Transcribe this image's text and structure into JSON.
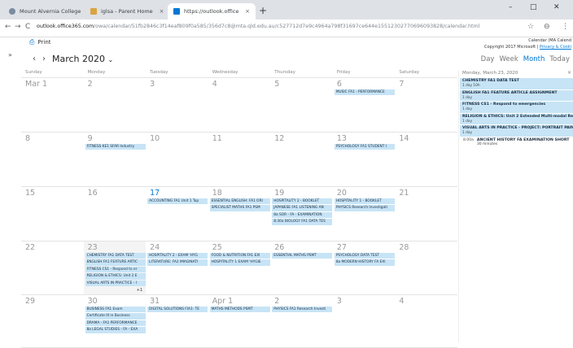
{
  "browser": {
    "tabs": [
      {
        "title": "Mount Alvernia College",
        "icon": "college-logo-icon",
        "active": false
      },
      {
        "title": "iglsa - Parent Home",
        "icon": "parent-portal-icon",
        "active": false
      },
      {
        "title": "https://outlook.office365.com/cale",
        "icon": "outlook-icon",
        "active": true
      }
    ],
    "new_tab": "+",
    "window_controls": [
      "–",
      "□",
      "✕"
    ],
    "url_domain": "outlook.office365.com",
    "url_rest": "/owa/calendar/51fb2846c3f14eaf809f0a585/356d7c8@mta.qld.edu.au/c527712d7e9c4964a798f31697ce644e15512302770696093828/calendar.html",
    "star": "☆",
    "account": "⊖",
    "menu": "⋮"
  },
  "print_label": "Print",
  "calendar_info": {
    "line1": "Calendar (MA Calend",
    "line2_prefix": "Copyright 2017 Microsoft |",
    "line2_link": "Privacy & Cooki"
  },
  "month_title": "March 2020",
  "views": [
    "Day",
    "Week",
    "Month",
    "Today"
  ],
  "active_view": "Month",
  "weekdays": [
    "Sunday",
    "Monday",
    "Tuesday",
    "Wednesday",
    "Thursday",
    "Friday",
    "Saturday"
  ],
  "weeks": [
    {
      "height": 67,
      "days": [
        {
          "num": "Mar 1",
          "events": []
        },
        {
          "num": "2",
          "events": []
        },
        {
          "num": "3",
          "events": []
        },
        {
          "num": "4",
          "events": []
        },
        {
          "num": "5",
          "events": []
        },
        {
          "num": "6",
          "events": [
            "MUSIC FA1 - PERFORMANCE"
          ]
        },
        {
          "num": "7",
          "events": []
        }
      ]
    },
    {
      "height": 67,
      "days": [
        {
          "num": "8",
          "events": []
        },
        {
          "num": "9",
          "events": [
            "FITNESS KE1 SFAR Industry"
          ]
        },
        {
          "num": "10",
          "events": []
        },
        {
          "num": "11",
          "events": []
        },
        {
          "num": "12",
          "events": []
        },
        {
          "num": "13",
          "events": [
            "PSYCHOLOGY FA1 STUDENT I"
          ]
        },
        {
          "num": "14",
          "events": []
        }
      ]
    },
    {
      "height": 67,
      "days": [
        {
          "num": "15",
          "events": []
        },
        {
          "num": "16",
          "events": []
        },
        {
          "num": "17",
          "blue": true,
          "events": [
            "ACCOUNTING FA1 Unit 1 Top"
          ]
        },
        {
          "num": "18",
          "events": [
            "ESSENTIAL ENGLISH: FA1 ORI",
            "SPECIALIST MATHS FA1 PSM"
          ]
        },
        {
          "num": "19",
          "events": [
            "HOSPITALITY 2 - BOOKLET",
            "JAPANESE FA1 LISTENING AN",
            "8a SOR - FA - EXAMINATION",
            "8:30a BIOLOGY FA1 DATA TES"
          ]
        },
        {
          "num": "20",
          "events": [
            "HOSPITALITY 1 - BOOKLET",
            "PHYSICS Research Investigati"
          ]
        },
        {
          "num": "21",
          "events": []
        }
      ]
    },
    {
      "height": 66,
      "days": [
        {
          "num": "22",
          "events": []
        },
        {
          "num": "23",
          "today": true,
          "events": [
            "CHEMISTRY FA1 DATA TEST",
            "ENGLISH FA1 FEATURE ARTIC",
            "FITNESS CS1 - Respond to er",
            "RELIGION & ETHICS: Unit 2 E",
            "VISUAL ARTS IN PRACTICE - I"
          ],
          "more": "+1"
        },
        {
          "num": "24",
          "events": [
            "HOSPITALITY 2 - EXAM 'HYG",
            "LITERATURE: FA2 IMAGINATI"
          ]
        },
        {
          "num": "25",
          "events": [
            "FOOD & NUTRITION FA1 EXI",
            "HOSPITALITY 1 EXAM 'HYGIE"
          ]
        },
        {
          "num": "26",
          "events": [
            "ESSENTIAL MATHS PSMT"
          ]
        },
        {
          "num": "27",
          "events": [
            "PSYCHOLOGY DATA TEST",
            "8a MODERN HISTORY FA EXI"
          ]
        },
        {
          "num": "28",
          "events": []
        }
      ]
    },
    {
      "height": 65,
      "days": [
        {
          "num": "29",
          "events": []
        },
        {
          "num": "30",
          "events": [
            "BUSINESS FA1 Exam",
            "Certificate III in Business",
            "DRAMA - FA1 PERFORMANCE",
            "8a LEGAL STUDIES - FA - EXA"
          ]
        },
        {
          "num": "31",
          "events": [
            "DIGITAL SOLUTIONS FIA1- TE"
          ]
        },
        {
          "num": "Apr 1",
          "events": [
            "MATHS METHODS PSMT"
          ]
        },
        {
          "num": "2",
          "events": [
            "PHYSICS FA1 Research Investi"
          ]
        },
        {
          "num": "3",
          "events": []
        },
        {
          "num": "4",
          "events": []
        }
      ]
    }
  ],
  "agenda": {
    "date": "Monday, March 23, 2020",
    "close": "×",
    "all_day": [
      {
        "title": "CHEMISTRY FA1 DATA TEST",
        "detail": "1 day 10h"
      },
      {
        "title": "ENGLISH FA1 FEATURE ARTICLE ASSIGNMENT",
        "detail": "1 day"
      },
      {
        "title": "FITNESS CS1 - Respond to emergencies",
        "detail": "1 day"
      },
      {
        "title": "RELIGION & ETHICS: Unit 2 Extended Multi-modal Res",
        "detail": "1 day"
      },
      {
        "title": "VISUAL ARTS IN PRACTICE - PROJECT: PORTRAIT PAIN",
        "detail": "1 day"
      }
    ],
    "timed": [
      {
        "time": "8:00a",
        "title": "ANCIENT HISTORY FA EXAMINATION SHORT",
        "detail": "30 minutes"
      }
    ]
  }
}
